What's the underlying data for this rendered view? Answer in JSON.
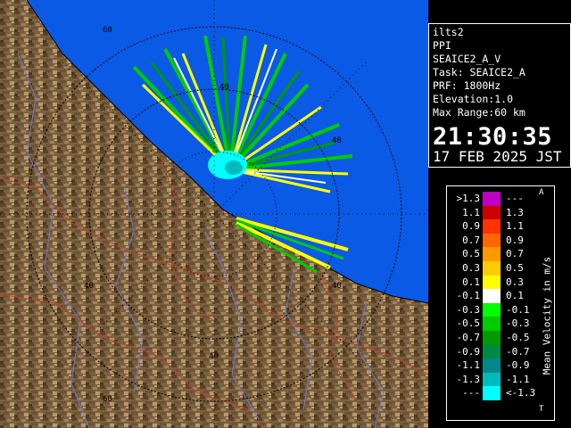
{
  "info": {
    "station": "ilts2",
    "mode": "PPI",
    "product": "SEAICE2_A_V",
    "task": "Task: SEAICE2_A",
    "prf": "PRF: 1800Hz",
    "elevation": "Elevation:1.0",
    "max_range": "Max Range:60 km",
    "time": "21:30:35",
    "date": "17 FEB 2025 JST"
  },
  "range_rings": {
    "labels": [
      "60",
      "40",
      "40",
      "40",
      "40",
      "40",
      "60"
    ]
  },
  "scale": {
    "title": "Mean Velocity in m/s",
    "marker_top": "A",
    "marker_bottom": "T",
    "levels": [
      {
        "low": ">1.3",
        "high": "---",
        "color": "#c000c0"
      },
      {
        "low": "1.1",
        "high": "1.3",
        "color": "#cc0000"
      },
      {
        "low": "0.9",
        "high": "1.1",
        "color": "#ff3300"
      },
      {
        "low": "0.7",
        "high": "0.9",
        "color": "#ff6600"
      },
      {
        "low": "0.5",
        "high": "0.7",
        "color": "#ff9900"
      },
      {
        "low": "0.3",
        "high": "0.5",
        "color": "#ffcc00"
      },
      {
        "low": "0.1",
        "high": "0.3",
        "color": "#ffff00"
      },
      {
        "low": "-0.1",
        "high": "0.1",
        "color": "#ffffff"
      },
      {
        "low": "-0.3",
        "high": "-0.1",
        "color": "#00ff00"
      },
      {
        "low": "-0.5",
        "high": "-0.3",
        "color": "#00cc00"
      },
      {
        "low": "-0.7",
        "high": "-0.5",
        "color": "#009900"
      },
      {
        "low": "-0.9",
        "high": "-0.7",
        "color": "#008844"
      },
      {
        "low": "-1.1",
        "high": "-0.9",
        "color": "#008888"
      },
      {
        "low": "-1.3",
        "high": "-1.1",
        "color": "#00bbbb"
      },
      {
        "low": "---",
        "high": "<-1.3",
        "color": "#00ffff"
      }
    ]
  },
  "colors": {
    "sea": "#0a5ae6",
    "land": "#7a6040",
    "ring": "#000000",
    "background": "#000000"
  }
}
